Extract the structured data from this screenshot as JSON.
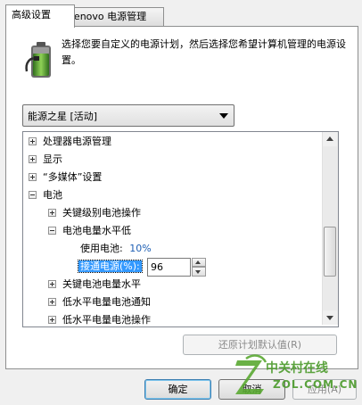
{
  "tabs": [
    {
      "label": "高级设置",
      "active": true
    },
    {
      "label": "Lenovo 电源管理",
      "active": false
    }
  ],
  "description": "选择您要自定义的电源计划，然后选择您希望计算机管理的电源设置。",
  "plan_select": {
    "value": "能源之星 [活动]"
  },
  "tree": [
    {
      "label": "处理器电源管理",
      "expander": "plus",
      "level": 0
    },
    {
      "label": "显示",
      "expander": "plus",
      "level": 0
    },
    {
      "label": "“多媒体”设置",
      "expander": "plus",
      "level": 0
    },
    {
      "label": "电池",
      "expander": "minus",
      "level": 0
    },
    {
      "label": "关键级别电池操作",
      "expander": "plus",
      "level": 1
    },
    {
      "label": "电池电量水平低",
      "expander": "minus",
      "level": 1
    },
    {
      "label": "关键电池电量水平",
      "expander": "plus",
      "level": 1
    },
    {
      "label": "低水平电量电池通知",
      "expander": "plus",
      "level": 1
    },
    {
      "label": "低水平电量电池操作",
      "expander": "plus",
      "level": 1
    }
  ],
  "battery_setting": {
    "label": "使用电池:",
    "value": "10%"
  },
  "plugged_setting": {
    "label": "接通电源(%):",
    "value": "96"
  },
  "buttons": {
    "restore": "还原计划默认值(R)",
    "ok": "确定",
    "cancel": "取消",
    "apply": "应用(A)"
  },
  "watermark": {
    "brand": "中关村在线",
    "domain": "ZOL.COM.CN"
  },
  "colors": {
    "accent": "#3399ff",
    "value_blue": "#1e5fb4",
    "brand_green": "#5aa832"
  }
}
